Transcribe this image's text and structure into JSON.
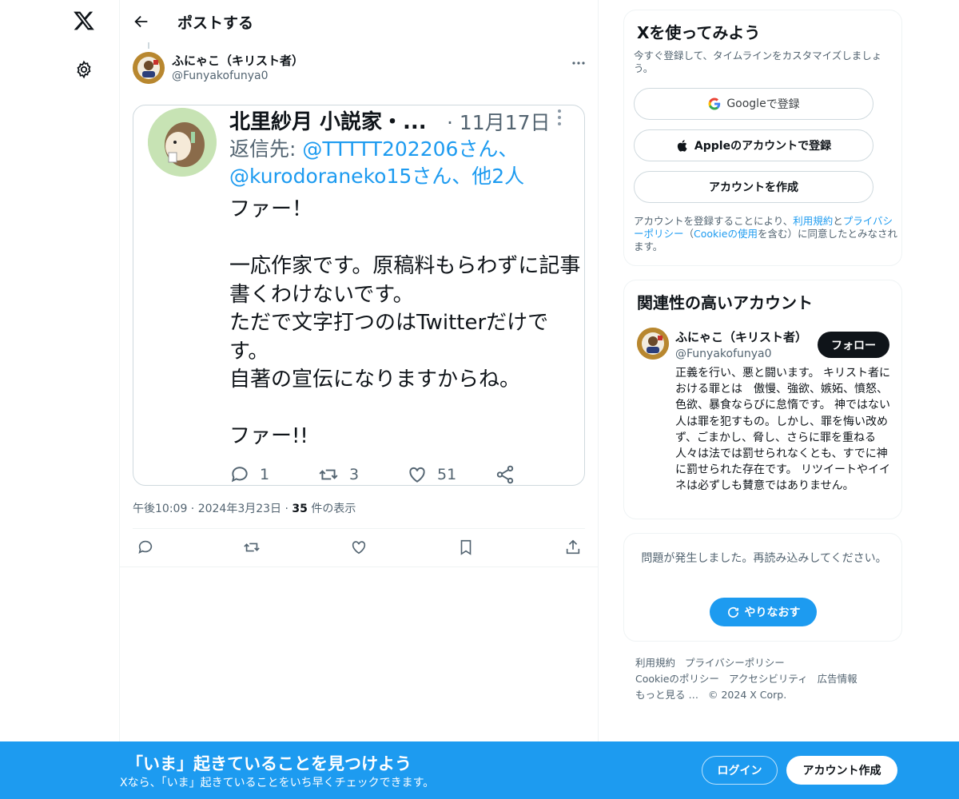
{
  "nav": {
    "logo_icon": "x-logo-icon",
    "settings_icon": "gear-icon"
  },
  "header": {
    "title": "ポストする",
    "back_icon": "arrow-left-icon"
  },
  "post": {
    "author_name": "ふにゃこ（キリスト者）",
    "author_handle": "@Funyakofunya0",
    "timestamp": "午後10:09 · 2024年3月23日 · ",
    "views_count": "35",
    "views_label": " 件の表示",
    "embedded": {
      "name": "北里紗月 小説家・...",
      "date": "· 11月17日",
      "reply_label": "返信先: ",
      "reply_to_1": "@TTTTT202206さん、",
      "reply_to_2": "@kurodoraneko15さん、他2人",
      "text": "ファー！\n\n一応作家です。原稿料もらわずに記事書くわけないです。\nただで文字打つのはTwitterだけです。\n自著の宣伝になりますからね。\n\nファー!!",
      "replies": "1",
      "retweets": "3",
      "likes": "51"
    }
  },
  "signup_card": {
    "title": "Xを使ってみよう",
    "subtitle": "今すぐ登録して、タイムラインをカスタマイズしましょう。",
    "google_brand": "Google",
    "google_suffix": " で登録",
    "apple_label": "Appleのアカウントで登録",
    "create_label": "アカウントを作成",
    "legal_1": "アカウントを登録することにより、",
    "legal_terms": "利用規約",
    "legal_and": "と",
    "legal_privacy": "プライバシーポリシー",
    "legal_2": "（",
    "legal_cookie": "Cookieの使用",
    "legal_3": "を含む）に同意したとみなされます。"
  },
  "related": {
    "title": "関連性の高いアカウント",
    "name": "ふにゃこ（キリスト者）",
    "handle": "@Funyakofunya0",
    "follow_label": "フォロー",
    "bio": "正義を行い、悪と闘います。 キリスト者における罪とは　傲慢、強欲、嫉妬、憤怒、色欲、暴食ならびに怠惰です。 神ではない人は罪を犯すもの。しかし、罪を悔い改めず、ごまかし、脅し、さらに罪を重ねる人々は法では罰せられなくとも、すでに神に罰せられた存在です。 リツイートやイイネは必ずしも賛意ではありません。"
  },
  "error_card": {
    "message": "問題が発生しました。再読み込みしてください。",
    "retry_label": "やりなおす"
  },
  "footer": {
    "terms": "利用規約",
    "privacy": "プライバシーポリシー",
    "cookie": "Cookieのポリシー",
    "accessibility": "アクセシビリティ",
    "ads": "広告情報",
    "more": "もっと見る …",
    "copyright": "© 2024 X Corp."
  },
  "bottom_bar": {
    "title": "「いま」起きていることを見つけよう",
    "subtitle": "Xなら、「いま」起きていることをいち早くチェックできます。",
    "login_label": "ログイン",
    "signup_label": "アカウント作成"
  },
  "colors": {
    "accent": "#1d9bf0",
    "text": "#0f1419",
    "secondary": "#536471",
    "border": "#eff3f4"
  }
}
